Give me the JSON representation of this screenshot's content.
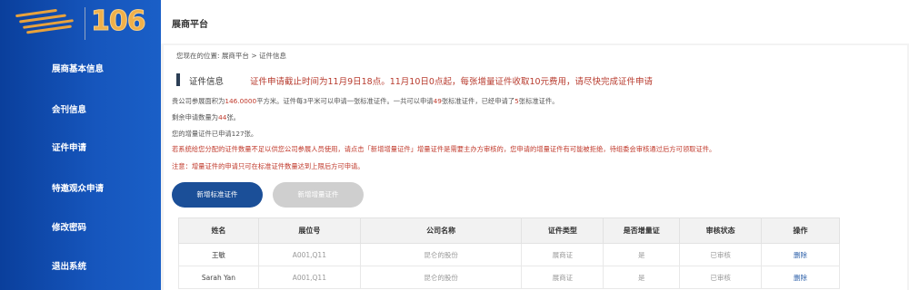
{
  "logo": {
    "number": "106"
  },
  "sidebar": {
    "items": [
      {
        "label": "展商基本信息"
      },
      {
        "label": "会刊信息"
      },
      {
        "label": "证件申请"
      },
      {
        "label": "特邀观众申请"
      },
      {
        "label": "修改密码"
      },
      {
        "label": "退出系统"
      }
    ]
  },
  "header": {
    "title": "展商平台"
  },
  "breadcrumb": {
    "prefix": "您现在的位置:",
    "level1": "展商平台",
    "separator": ">",
    "level2": "证件信息"
  },
  "notice": {
    "title": "证件信息",
    "text": "证件申请截止时间为11月9日18点。11月10日0点起，每张增量证件收取10元费用，请尽快完成证件申请"
  },
  "info": {
    "line1_a": "贵公司参展面积为",
    "line1_area": "146.0000",
    "line1_b": "平方米。证件每3平米可以申请一张标准证件。一共可以申请",
    "line1_total": "49",
    "line1_c": "张标准证件，已经申请了",
    "line1_used": "5",
    "line1_d": "张标准证件。",
    "line2_a": "剩余申请数量为",
    "line2_remaining": "44",
    "line2_b": "张。",
    "line3": "您的增量证件已申请127张。",
    "warning1": "若系统给您分配的证件数量不足以供您公司参展人员使用，请点击「新增增量证件」增量证件是需要主办方审核的，您申请的增量证件有可能被拒绝，待组委会审核通过后方可领取证件。",
    "warning2": "注意：增量证件的申请只可在标准证件数量达到上限后方可申请。"
  },
  "buttons": {
    "add_standard": "新增标准证件",
    "add_incremental": "新增增量证件"
  },
  "table": {
    "headers": [
      "姓名",
      "展位号",
      "公司名称",
      "证件类型",
      "是否增量证",
      "审核状态",
      "操作"
    ],
    "rows": [
      {
        "name": "王敏",
        "booth": "A001,Q11",
        "company": "昆仑的股份",
        "type": "展商证",
        "incremental": "是",
        "status": "已审核",
        "action": "删除"
      },
      {
        "name": "Sarah Yan",
        "booth": "A001,Q11",
        "company": "昆仑的股份",
        "type": "展商证",
        "incremental": "是",
        "status": "已审核",
        "action": "删除"
      }
    ]
  },
  "colors": {
    "sidebar": "#1656bd",
    "accent_red": "#b73a2d",
    "primary_button": "#1b4f98",
    "logo_gold": "#f0b04a"
  }
}
